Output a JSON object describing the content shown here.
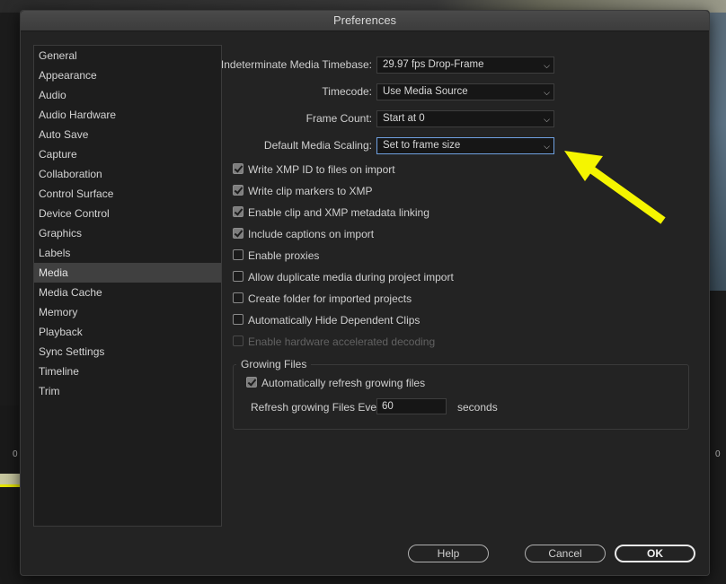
{
  "window": {
    "title": "Preferences"
  },
  "sidebar": {
    "items": [
      {
        "label": "General"
      },
      {
        "label": "Appearance"
      },
      {
        "label": "Audio"
      },
      {
        "label": "Audio Hardware"
      },
      {
        "label": "Auto Save"
      },
      {
        "label": "Capture"
      },
      {
        "label": "Collaboration"
      },
      {
        "label": "Control Surface"
      },
      {
        "label": "Device Control"
      },
      {
        "label": "Graphics"
      },
      {
        "label": "Labels"
      },
      {
        "label": "Media"
      },
      {
        "label": "Media Cache"
      },
      {
        "label": "Memory"
      },
      {
        "label": "Playback"
      },
      {
        "label": "Sync Settings"
      },
      {
        "label": "Timeline"
      },
      {
        "label": "Trim"
      }
    ],
    "selected": "Media"
  },
  "form": {
    "timebase": {
      "label": "Indeterminate Media Timebase:",
      "value": "29.97 fps Drop-Frame"
    },
    "timecode": {
      "label": "Timecode:",
      "value": "Use Media Source"
    },
    "frame_count": {
      "label": "Frame Count:",
      "value": "Start at 0"
    },
    "scaling": {
      "label": "Default Media Scaling:",
      "value": "Set to frame size"
    }
  },
  "checkboxes": [
    {
      "label": "Write XMP ID to files on import",
      "checked": true
    },
    {
      "label": "Write clip markers to XMP",
      "checked": true
    },
    {
      "label": "Enable clip and XMP metadata linking",
      "checked": true
    },
    {
      "label": "Include captions on import",
      "checked": true
    },
    {
      "label": "Enable proxies",
      "checked": false
    },
    {
      "label": "Allow duplicate media during project import",
      "checked": false
    },
    {
      "label": "Create folder for imported projects",
      "checked": false
    },
    {
      "label": "Automatically Hide Dependent Clips",
      "checked": false
    },
    {
      "label": "Enable hardware accelerated decoding",
      "checked": false,
      "disabled": true
    }
  ],
  "growing_files": {
    "title": "Growing Files",
    "auto_refresh": {
      "label": "Automatically refresh growing files",
      "checked": true
    },
    "refresh_every": {
      "label": "Refresh growing Files Every",
      "value": "60",
      "unit": "seconds"
    }
  },
  "buttons": {
    "help": "Help",
    "cancel": "Cancel",
    "ok": "OK"
  },
  "background": {
    "left_tick": "0",
    "right_tick": "0"
  },
  "annotation": {
    "arrow_color": "#f5f500"
  }
}
